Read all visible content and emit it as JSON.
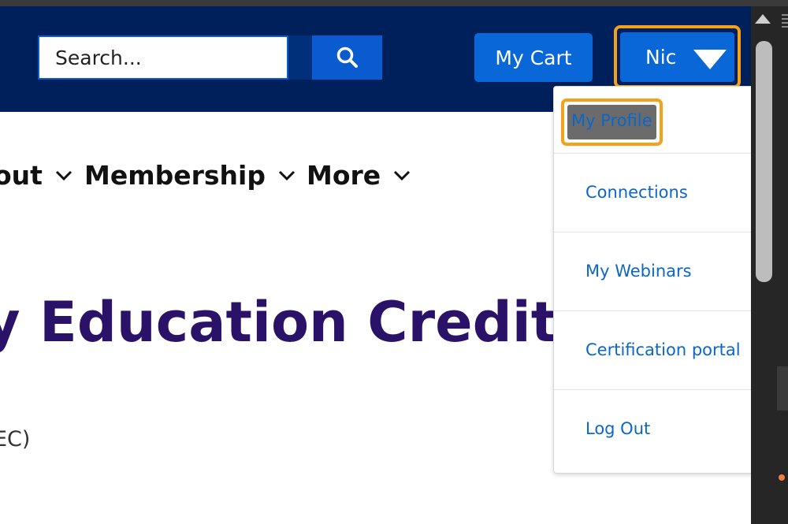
{
  "header": {
    "search": {
      "placeholder": "Search..."
    },
    "cart_label": "My Cart",
    "user_name": "Nic"
  },
  "nav": {
    "items": [
      {
        "label": "out"
      },
      {
        "label": "Membership"
      },
      {
        "label": "More"
      }
    ]
  },
  "main": {
    "title": "y Education Credits I",
    "subtext": "EC)"
  },
  "user_menu": {
    "items": [
      {
        "label": "My Profile"
      },
      {
        "label": "Connections"
      },
      {
        "label": "My Webinars"
      },
      {
        "label": "Certification portal"
      },
      {
        "label": "Log Out"
      }
    ]
  },
  "colors": {
    "header_bg": "#00205b",
    "button_blue": "#0a67d7",
    "focus_ring": "#f3a21a",
    "title_purple": "#2a1268",
    "link_blue": "#0a67c9"
  }
}
